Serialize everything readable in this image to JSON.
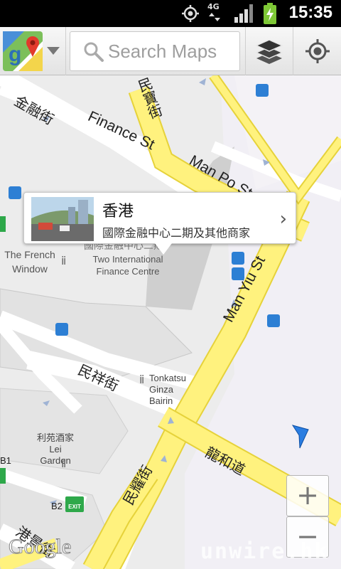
{
  "status_bar": {
    "time": "15:35",
    "network": "4G"
  },
  "search": {
    "placeholder": "Search Maps"
  },
  "map": {
    "streets": [
      {
        "name": "金融街"
      },
      {
        "name": "民寶街"
      },
      {
        "name": "Finance St"
      },
      {
        "name": "Man Po St"
      },
      {
        "name": "Man Yiu St"
      },
      {
        "name": "民祥街"
      },
      {
        "name": "龍和道"
      },
      {
        "name": "民耀街"
      },
      {
        "name": "港景街"
      }
    ],
    "places": [
      {
        "name": "The French Window"
      },
      {
        "name": "國際金融中心二期"
      },
      {
        "name": "Two International Finance Centre"
      },
      {
        "name": "Tonkatsu Ginza Bairin"
      },
      {
        "name": "利苑酒家 Lei Garden"
      },
      {
        "name": "B2"
      },
      {
        "name": "B1"
      }
    ],
    "exit_label": "EXIT"
  },
  "info_bubble": {
    "title": "香港",
    "subtitle": "國際金融中心二期及其他商家",
    "action": "›"
  },
  "zoom": {
    "in_label": "+",
    "out_label": "−"
  },
  "attribution": {
    "logo": "Google",
    "watermark": "unwire.hk"
  },
  "colors": {
    "road_major": "#fff27e",
    "road_minor": "#ffffff",
    "map_bg": "#ececec",
    "accent": "#1a73e8"
  }
}
